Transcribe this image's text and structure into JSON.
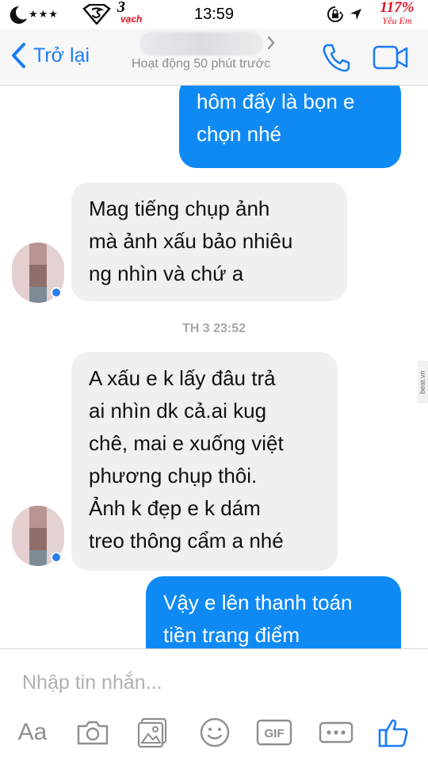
{
  "status_bar": {
    "stars": "★★★",
    "carrier_number": "3",
    "carrier_text": "vạch",
    "time": "13:59",
    "battery_percent": "117%",
    "battery_label": "Yêu Em"
  },
  "nav": {
    "back_label": "Trở lại",
    "subtitle": "Hoạt động 50 phút trước"
  },
  "messages": [
    {
      "direction": "sent",
      "lines": [
        "hôm đấy là bọn e",
        "chọn nhé"
      ]
    },
    {
      "direction": "received",
      "lines": [
        "Mag tiếng chụp ảnh",
        "mà ảnh xấu bảo nhiêu",
        "ng nhìn và chứ a"
      ]
    },
    {
      "direction": "received",
      "lines": [
        "A xấu e k lấy đâu trả",
        "ai nhìn dk cả.ai kug",
        "chê, mai e xuống việt",
        "phương chụp thôi.",
        "Ảnh k đẹp e k dám",
        "treo thông cẩm a nhé"
      ]
    },
    {
      "direction": "sent",
      "lines": [
        "Vậy e lên thanh toán",
        "tiền trang điểm"
      ]
    }
  ],
  "timestamp": "TH 3 23:52",
  "watermark": "beat.vn",
  "composer": {
    "placeholder": "Nhập tin nhắn...",
    "aa_label": "Aa",
    "gif_label": "GIF"
  },
  "colors": {
    "accent": "#1d7cf5",
    "sent_bubble": "#0f8af5",
    "received_bubble": "#f1f0f0",
    "battery_red": "#e0101e"
  },
  "icons": {
    "back": "chevron-left-icon",
    "call": "phone-icon",
    "video": "video-camera-icon",
    "camera": "camera-icon",
    "photo": "photo-gallery-icon",
    "sticker": "smiley-icon",
    "gif": "gif-icon",
    "more": "more-dots-icon",
    "like": "thumbs-up-icon"
  }
}
